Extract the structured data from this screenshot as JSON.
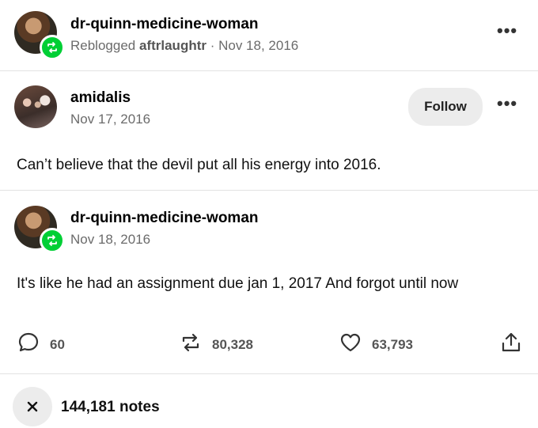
{
  "reblog_header": {
    "username": "dr-quinn-medicine-woman",
    "reblogged_prefix": "Reblogged",
    "reblogged_from": "aftrlaughtr",
    "separator": " · ",
    "date": "Nov 18, 2016",
    "more_icon": "more-dots-icon"
  },
  "original_post": {
    "username": "amidalis",
    "date": "Nov 17, 2016",
    "follow_label": "Follow",
    "text": "Can’t believe that the devil put all his energy into 2016."
  },
  "reply_post": {
    "username": "dr-quinn-medicine-woman",
    "date": "Nov 18, 2016",
    "text": "It's like he had an assignment due jan 1, 2017 And forgot until now"
  },
  "actions": {
    "comments": "60",
    "reblogs": "80,328",
    "likes": "63,793"
  },
  "footer": {
    "notes": "144,181 notes"
  },
  "colors": {
    "reblog_badge": "#00cf35",
    "divider": "#e2e2e2"
  }
}
